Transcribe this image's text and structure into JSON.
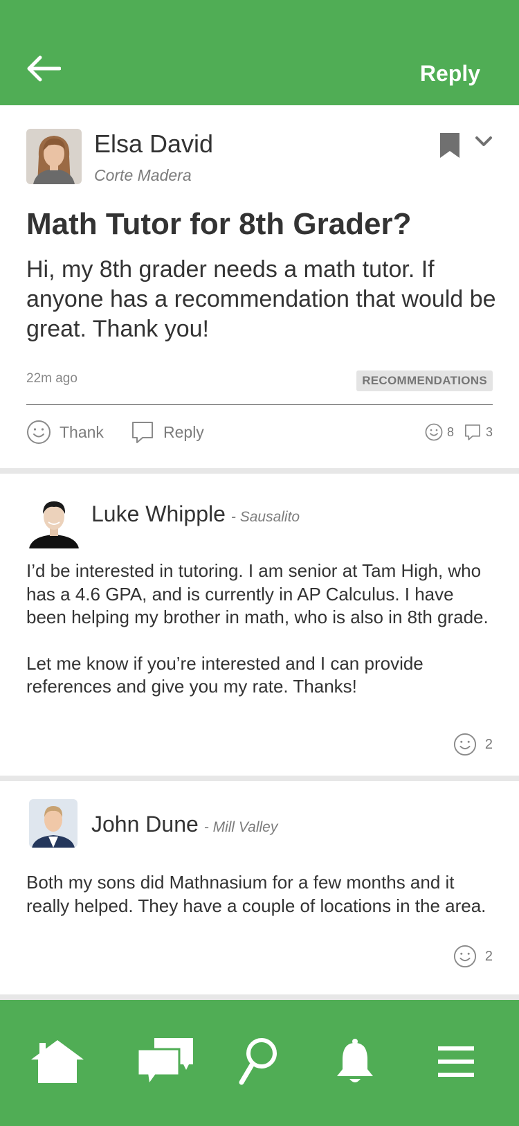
{
  "header": {
    "back_icon": "arrow-left-icon",
    "reply_label": "Reply",
    "accent_color": "#50ad55"
  },
  "post": {
    "author": {
      "name": "Elsa David",
      "location": "Corte Madera"
    },
    "title": "Math Tutor for 8th Grader?",
    "body": "Hi, my 8th grader needs a math tutor. If anyone has a recommendation that would be great. Thank you!",
    "time_ago": "22m ago",
    "category": "RECOMMENDATIONS",
    "actions": {
      "thank_label": "Thank",
      "reply_label": "Reply"
    },
    "thank_count": "8",
    "reply_count": "3"
  },
  "replies": [
    {
      "name": "Luke Whipple",
      "location": "- Sausalito",
      "paragraphs": [
        "I’d be interested in tutoring. I am senior at Tam High, who has a 4.6 GPA, and is currently in AP Calculus. I have been helping my brother in math, who is also in 8th grade.",
        "Let me know if you’re interested and I can provide references and give you my rate. Thanks!"
      ],
      "thank_count": "2"
    },
    {
      "name": "John Dune",
      "location": "- Mill Valley",
      "paragraphs": [
        "Both my sons did Mathnasium for a few months and it really helped. They have a couple of locations in the area."
      ],
      "thank_count": "2"
    }
  ],
  "bottom_nav": {
    "items": [
      "home-icon",
      "messages-icon",
      "search-icon",
      "bell-icon",
      "menu-icon"
    ]
  }
}
